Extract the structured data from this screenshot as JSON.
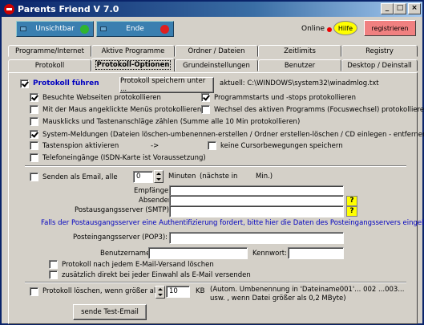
{
  "window": {
    "title": "Parents Friend V 7.0",
    "min": "_",
    "max": "□",
    "close": "×"
  },
  "header": {
    "invisible_label": "Unsichtbar",
    "invisible_color": "#2fb52f",
    "end_label": "Ende",
    "end_color": "#e02020",
    "online_label": "Online",
    "help_label": "Hilfe",
    "register_label": "registrieren"
  },
  "tabs_row1": [
    "Programme/Internet",
    "Aktive Programme",
    "Ordner / Dateien",
    "Zeitlimits",
    "Registry"
  ],
  "tabs_row2": [
    "Protokoll",
    "Protokoll-Optionen",
    "Grundeinstellungen",
    "Benutzer",
    "Desktop / Deinstall"
  ],
  "protocol": {
    "enabled_label": "Protokoll führen",
    "enabled": true,
    "save_button": "Protokoll speichern unter ...",
    "current_path": "aktuell: C:\\WINDOWS\\system32\\winadmlog.txt"
  },
  "options": [
    {
      "label": "Besuchte Webseiten protokollieren",
      "checked": true
    },
    {
      "label": "Programmstarts und -stops protokollieren",
      "checked": true
    },
    {
      "label": "Mit der Maus angeklickte Menüs protokollieren",
      "checked": false
    },
    {
      "label": "Wechsel des aktiven Programms (Focuswechsel) protokollieren",
      "checked": false
    },
    {
      "label": "Mausklicks und Tastenanschläge zählen (Summe alle 10 Min protokollieren)",
      "checked": false
    },
    {
      "label": "System-Meldungen (Dateien löschen-umbenennen-erstellen / Ordner erstellen-löschen / CD einlegen - entfernen)",
      "checked": true
    },
    {
      "label": "Tastenspion aktivieren",
      "checked": false
    },
    {
      "label": "->",
      "checked": false
    },
    {
      "label": "keine Cursorbewegungen speichern",
      "checked": false
    },
    {
      "label": "Telefoneingänge (ISDN-Karte ist Voraussetzung)",
      "checked": false
    }
  ],
  "email": {
    "send_label": "Senden als Email, alle",
    "send_checked": false,
    "minutes_value": "0",
    "minutes_label": "Minuten",
    "minutes_hint": "(nächste in",
    "minutes_hint_end": "Min.)",
    "recipient_label": "Empfänger:",
    "sender_label": "Absender:",
    "smtp_label": "Postausgangsserver (SMTP):",
    "auth_note": "Falls der Postausgangsserver eine Authentifizierung fordert, bitte hier die Daten des Posteingangsservers eingeben:",
    "pop3_label": "Posteingangsserver (POP3):",
    "user_label": "Benutzername:",
    "password_label": "Kennwort:",
    "delete_after_send": "Protokoll nach jedem E-Mail-Versand  löschen",
    "send_on_dialin": "zusätzlich direkt bei jeder Einwahl als E-Mail versenden",
    "question": "?"
  },
  "delete": {
    "label": "Protokoll löschen, wenn größer als",
    "checked": false,
    "value": "10",
    "unit": "KB",
    "note1": "(Autom. Umbenennung in 'Dateiname001'... 002 ...003...",
    "note2": "usw. , wenn Datei größer als 0,2 MByte)"
  },
  "test_button": "sende Test-Email"
}
